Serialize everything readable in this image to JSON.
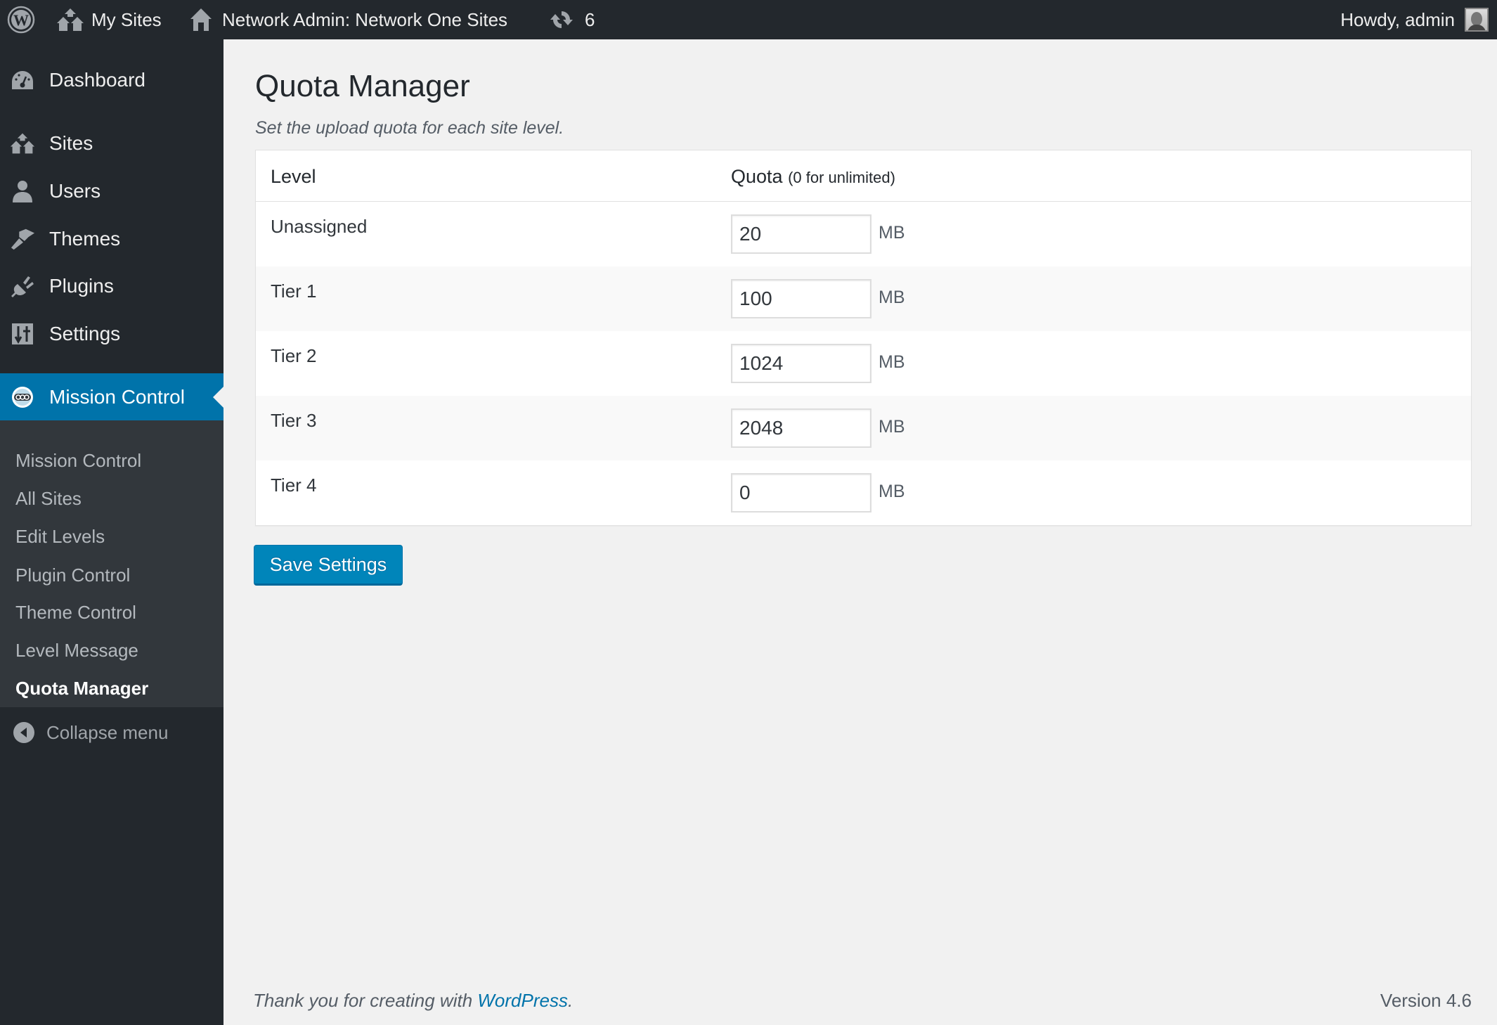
{
  "adminbar": {
    "my_sites": "My Sites",
    "network_admin": "Network Admin: Network One Sites",
    "updates_count": "6",
    "howdy": "Howdy, admin"
  },
  "sidebar": {
    "items": [
      {
        "label": "Dashboard",
        "icon": "dashboard-icon"
      },
      {
        "label": "Sites",
        "icon": "sites-icon"
      },
      {
        "label": "Users",
        "icon": "users-icon"
      },
      {
        "label": "Themes",
        "icon": "themes-icon"
      },
      {
        "label": "Plugins",
        "icon": "plugins-icon"
      },
      {
        "label": "Settings",
        "icon": "settings-icon"
      },
      {
        "label": "Mission Control",
        "icon": "mission-control-icon",
        "active": true
      }
    ],
    "submenu": [
      {
        "label": "Mission Control"
      },
      {
        "label": "All Sites"
      },
      {
        "label": "Edit Levels"
      },
      {
        "label": "Plugin Control"
      },
      {
        "label": "Theme Control"
      },
      {
        "label": "Level Message"
      },
      {
        "label": "Quota Manager",
        "current": true
      }
    ],
    "collapse_label": "Collapse menu"
  },
  "page": {
    "title": "Quota Manager",
    "description": "Set the upload quota for each site level."
  },
  "table": {
    "headers": {
      "level": "Level",
      "quota": "Quota",
      "quota_note": "(0 for unlimited)"
    },
    "rows": [
      {
        "level": "Unassigned",
        "quota": "20",
        "unit": "MB"
      },
      {
        "level": "Tier 1",
        "quota": "100",
        "unit": "MB"
      },
      {
        "level": "Tier 2",
        "quota": "1024",
        "unit": "MB"
      },
      {
        "level": "Tier 3",
        "quota": "2048",
        "unit": "MB"
      },
      {
        "level": "Tier 4",
        "quota": "0",
        "unit": "MB"
      }
    ]
  },
  "actions": {
    "save_label": "Save Settings"
  },
  "footer": {
    "thanks_prefix": "Thank you for creating with ",
    "thanks_link": "WordPress",
    "thanks_suffix": ".",
    "version": "Version 4.6"
  },
  "colors": {
    "adminbar_bg": "#23282d",
    "accent": "#0073aa",
    "button": "#0085ba",
    "content_bg": "#f1f1f1"
  }
}
